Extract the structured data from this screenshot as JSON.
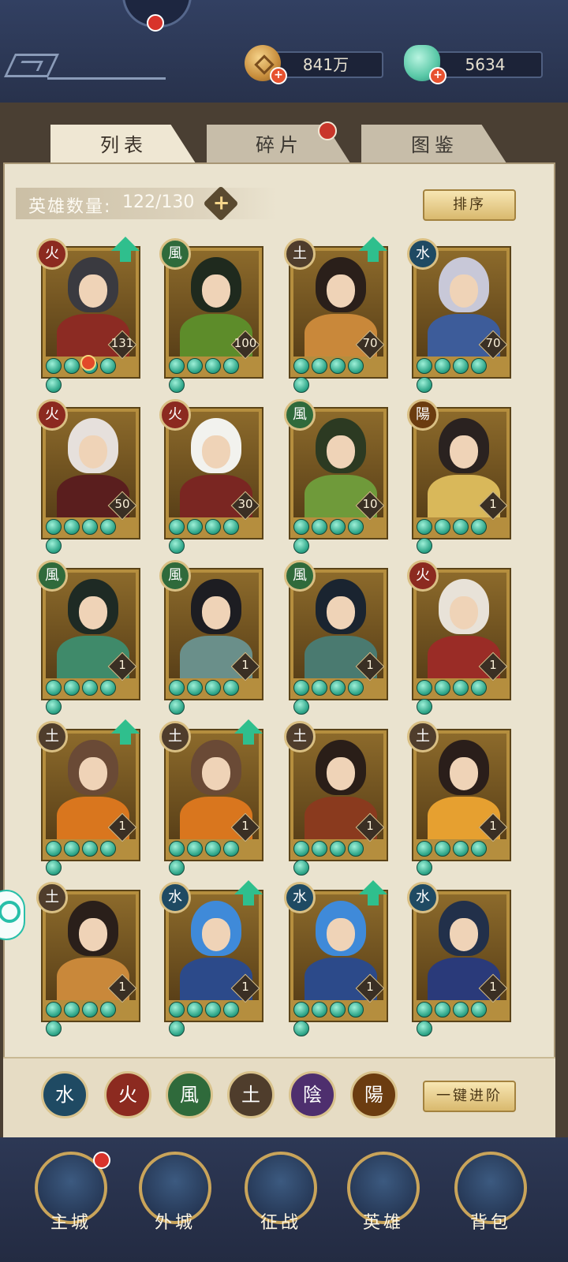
{
  "currencies": {
    "coins": "841万",
    "jade": "5634"
  },
  "tabs": [
    {
      "label": "列表",
      "active": true
    },
    {
      "label": "碎片",
      "active": false,
      "badge": true
    },
    {
      "label": "图鉴",
      "active": false
    }
  ],
  "hero_count": {
    "label": "英雄数量:",
    "value": "122/130"
  },
  "sort_label": "排序",
  "element_glyphs": {
    "fire": "火",
    "wind": "風",
    "earth": "土",
    "water": "水",
    "yin": "陰",
    "yang": "陽"
  },
  "heroes": [
    {
      "element": "火",
      "level": "131",
      "stars": 5,
      "upgrade": true,
      "hair": "#3a3a40",
      "body": "#8c2b23"
    },
    {
      "element": "風",
      "level": "100",
      "stars": 5,
      "upgrade": false,
      "hair": "#1f2a1e",
      "body": "#5d8c2a"
    },
    {
      "element": "土",
      "level": "70",
      "stars": 5,
      "upgrade": true,
      "hair": "#2a1f1a",
      "body": "#c9883a"
    },
    {
      "element": "水",
      "level": "70",
      "stars": 5,
      "upgrade": false,
      "hair": "#c8c8d8",
      "body": "#3d5c9a"
    },
    {
      "element": "火",
      "level": "50",
      "stars": 5,
      "upgrade": false,
      "hair": "#e6e0dc",
      "body": "#5a1e1e"
    },
    {
      "element": "火",
      "level": "30",
      "stars": 5,
      "upgrade": false,
      "hair": "#f2f2ee",
      "body": "#7a2622"
    },
    {
      "element": "風",
      "level": "10",
      "stars": 5,
      "upgrade": false,
      "hair": "#2c3a22",
      "body": "#6f9a3a"
    },
    {
      "element": "陽",
      "level": "1",
      "stars": 5,
      "upgrade": false,
      "hair": "#2a2220",
      "body": "#d9b85a"
    },
    {
      "element": "風",
      "level": "1",
      "stars": 5,
      "upgrade": false,
      "hair": "#1e2a24",
      "body": "#3f8a6a"
    },
    {
      "element": "風",
      "level": "1",
      "stars": 5,
      "upgrade": false,
      "hair": "#1d1d22",
      "body": "#6a8f8a"
    },
    {
      "element": "風",
      "level": "1",
      "stars": 5,
      "upgrade": false,
      "hair": "#1a2430",
      "body": "#4a7a70"
    },
    {
      "element": "火",
      "level": "1",
      "stars": 5,
      "upgrade": false,
      "hair": "#e8e2d8",
      "body": "#9a2c26"
    },
    {
      "element": "土",
      "level": "1",
      "stars": 5,
      "upgrade": true,
      "hair": "#6a4a36",
      "body": "#d9761e"
    },
    {
      "element": "土",
      "level": "1",
      "stars": 5,
      "upgrade": true,
      "hair": "#6a4a36",
      "body": "#d9761e"
    },
    {
      "element": "土",
      "level": "1",
      "stars": 5,
      "upgrade": false,
      "hair": "#2a1e18",
      "body": "#8a3a1e"
    },
    {
      "element": "土",
      "level": "1",
      "stars": 5,
      "upgrade": false,
      "hair": "#2a1e1a",
      "body": "#e6a030"
    },
    {
      "element": "土",
      "level": "1",
      "stars": 5,
      "upgrade": false,
      "hair": "#2a1f1a",
      "body": "#c9883a"
    },
    {
      "element": "水",
      "level": "1",
      "stars": 5,
      "upgrade": true,
      "hair": "#3f8ad9",
      "body": "#2c4a8a"
    },
    {
      "element": "水",
      "level": "1",
      "stars": 5,
      "upgrade": true,
      "hair": "#3f8ad9",
      "body": "#2c4a8a"
    },
    {
      "element": "水",
      "level": "1",
      "stars": 5,
      "upgrade": false,
      "hair": "#22304a",
      "body": "#2a3a7a"
    }
  ],
  "filters": [
    {
      "glyph": "水",
      "color": "#1f4a63"
    },
    {
      "glyph": "火",
      "color": "#8c2a20"
    },
    {
      "glyph": "風",
      "color": "#2f6a3b"
    },
    {
      "glyph": "土",
      "color": "#4f3d2c"
    },
    {
      "glyph": "陰",
      "color": "#4e2f6e"
    },
    {
      "glyph": "陽",
      "color": "#6b3c10"
    }
  ],
  "advance_all_label": "一键进阶",
  "nav": [
    {
      "label": "主城",
      "badge": true
    },
    {
      "label": "外城",
      "badge": false
    },
    {
      "label": "征战",
      "badge": false
    },
    {
      "label": "英雄",
      "badge": false,
      "active": true
    },
    {
      "label": "背包",
      "badge": false
    }
  ]
}
